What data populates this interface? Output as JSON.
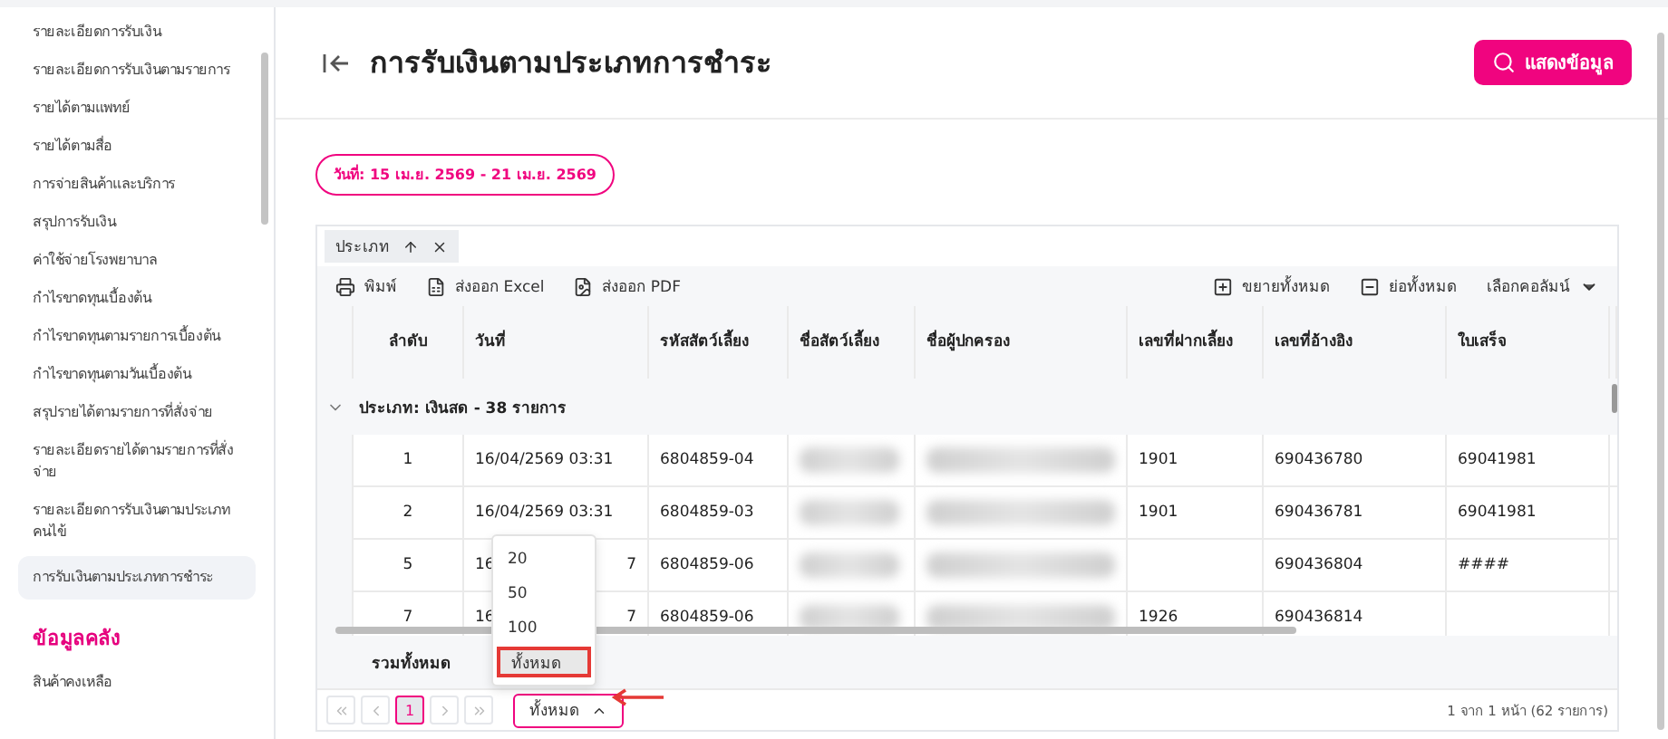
{
  "sidebar": {
    "items": [
      {
        "label": "รายละเอียดการรับเงิน",
        "selected": false
      },
      {
        "label": "รายละเอียดการรับเงินตามรายการ",
        "selected": false
      },
      {
        "label": "รายได้ตามแพทย์",
        "selected": false
      },
      {
        "label": "รายได้ตามสื่อ",
        "selected": false
      },
      {
        "label": "การจ่ายสินค้าและบริการ",
        "selected": false
      },
      {
        "label": "สรุปการรับเงิน",
        "selected": false
      },
      {
        "label": "ค่าใช้จ่ายโรงพยาบาล",
        "selected": false
      },
      {
        "label": "กำไรขาดทุนเบื้องต้น",
        "selected": false
      },
      {
        "label": "กำไรขาดทุนตามรายการเบื้องต้น",
        "selected": false
      },
      {
        "label": "กำไรขาดทุนตามวันเบื้องต้น",
        "selected": false
      },
      {
        "label": "สรุปรายได้ตามรายการที่สั่งจ่าย",
        "selected": false
      },
      {
        "label": "รายละเอียดรายได้ตามรายการที่สั่งจ่าย",
        "selected": false
      },
      {
        "label": "รายละเอียดการรับเงินตามประเภทคนไข้",
        "selected": false
      },
      {
        "label": "การรับเงินตามประเภทการชำระ",
        "selected": true
      }
    ],
    "section": "ข้อมูลคลัง",
    "section_items": [
      "สินค้าคงเหลือ"
    ]
  },
  "header": {
    "title": "การรับเงินตามประเภทการชำระ",
    "button": "แสดงข้อมูล"
  },
  "date_chip": "วันที่: 15 เม.ย. 2569 - 21 เม.ย. 2569",
  "group_chip": {
    "label": "ประเภท"
  },
  "toolbar": {
    "left": [
      {
        "kind": "print",
        "label": "พิมพ์"
      },
      {
        "kind": "excel",
        "label": "ส่งออก Excel"
      },
      {
        "kind": "pdf",
        "label": "ส่งออก PDF"
      }
    ],
    "right": [
      {
        "kind": "expand",
        "label": "ขยายทั้งหมด"
      },
      {
        "kind": "collapse",
        "label": "ย่อทั้งหมด"
      },
      {
        "kind": "columns",
        "label": "เลือกคอลัมน์"
      }
    ]
  },
  "table": {
    "columns": [
      "ลำดับ",
      "วันที่",
      "รหัสสัตว์เลี้ยง",
      "ชื่อสัตว์เลี้ยง",
      "ชื่อผู้ปกครอง",
      "เลขที่ฝากเลี้ยง",
      "เลขที่อ้างอิง",
      "ใบเสร็จ"
    ],
    "group": {
      "label": "ประเภท: เงินสด - 38 รายการ",
      "expanded": true
    },
    "rows": [
      [
        "1",
        "16/04/2569 03:31",
        "6804859-04",
        "",
        "",
        "1901",
        "690436780",
        "69041981"
      ],
      [
        "2",
        "16/04/2569 03:31",
        "6804859-03",
        "",
        "",
        "1901",
        "690436781",
        "69041981"
      ],
      [
        "5",
        [
          "16",
          "7"
        ],
        "6804859-06",
        "",
        "",
        "",
        "690436804",
        "####"
      ],
      [
        "7",
        [
          "16",
          "7"
        ],
        "6804859-06",
        "",
        "",
        "1926",
        "690436814",
        ""
      ]
    ],
    "total_label": "รวมทั้งหมด"
  },
  "pagination": {
    "pages": [
      {
        "label": "1",
        "selected": true
      }
    ],
    "page_size": "ทั้งหมด",
    "expanded": true,
    "options": [
      {
        "label": "20",
        "selected": false
      },
      {
        "label": "50",
        "selected": false
      },
      {
        "label": "100",
        "selected": false
      },
      {
        "label": "ทั้งหมด",
        "selected": true
      }
    ],
    "summary": "1 จาก 1 หน้า (62 รายการ)"
  }
}
